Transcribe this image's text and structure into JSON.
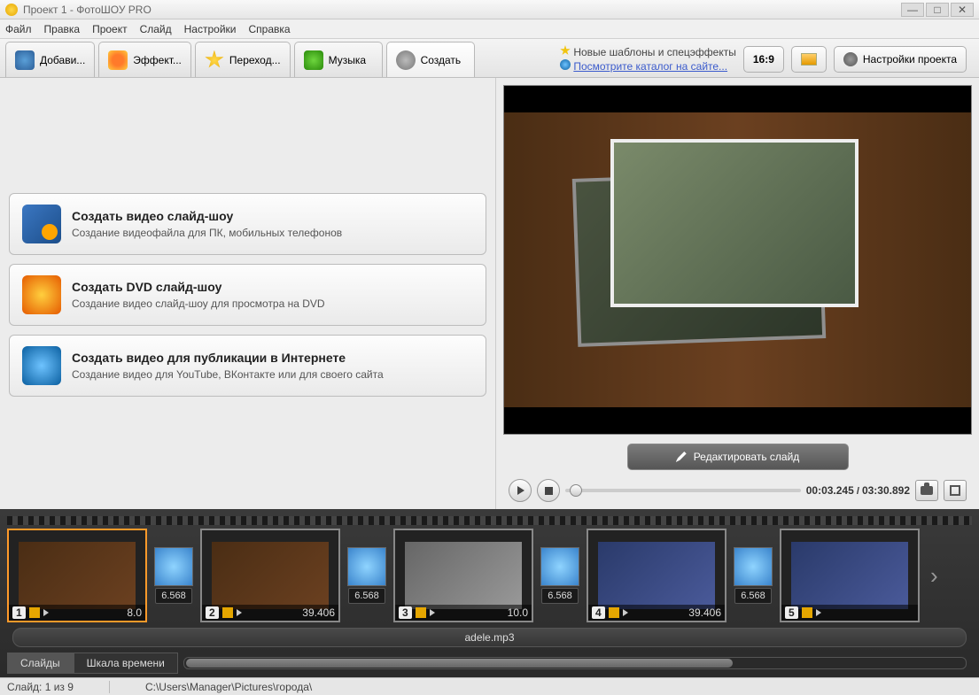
{
  "window": {
    "title": "Проект 1 - ФотоШОУ PRO"
  },
  "menu": {
    "file": "Файл",
    "edit": "Правка",
    "project": "Проект",
    "slide": "Слайд",
    "settings": "Настройки",
    "help": "Справка"
  },
  "tabs": {
    "add": "Добави...",
    "effects": "Эффект...",
    "transitions": "Переход...",
    "music": "Музыка",
    "create": "Создать"
  },
  "rightbar": {
    "templates_line": "Новые шаблоны и спецэффекты",
    "catalog_link": "Посмотрите каталог на сайте...",
    "aspect": "16:9",
    "projsettings": "Настройки проекта"
  },
  "options": {
    "video": {
      "title": "Создать видео слайд-шоу",
      "desc": "Создание видеофайла для ПК, мобильных телефонов"
    },
    "dvd": {
      "title": "Создать DVD слайд-шоу",
      "desc": "Создание видео слайд-шоу для просмотра на DVD"
    },
    "web": {
      "title": "Создать видео для публикации в Интернете",
      "desc": "Создание видео для YouTube, ВКонтакте или для своего сайта"
    }
  },
  "preview": {
    "edit_slide": "Редактировать слайд",
    "time_current": "00:03.245",
    "time_total": "03:30.892"
  },
  "timeline": {
    "slides": [
      {
        "num": "1",
        "duration": "8.0"
      },
      {
        "num": "2",
        "duration": "39.406"
      },
      {
        "num": "3",
        "duration": "10.0"
      },
      {
        "num": "4",
        "duration": "39.406"
      },
      {
        "num": "5",
        "duration": ""
      }
    ],
    "transition_time": "6.568",
    "audio": "adele.mp3",
    "view_slides": "Слайды",
    "view_timeline": "Шкала времени"
  },
  "status": {
    "slide_counter": "Слайд: 1 из 9",
    "path": "C:\\Users\\Manager\\Pictures\\города\\"
  }
}
